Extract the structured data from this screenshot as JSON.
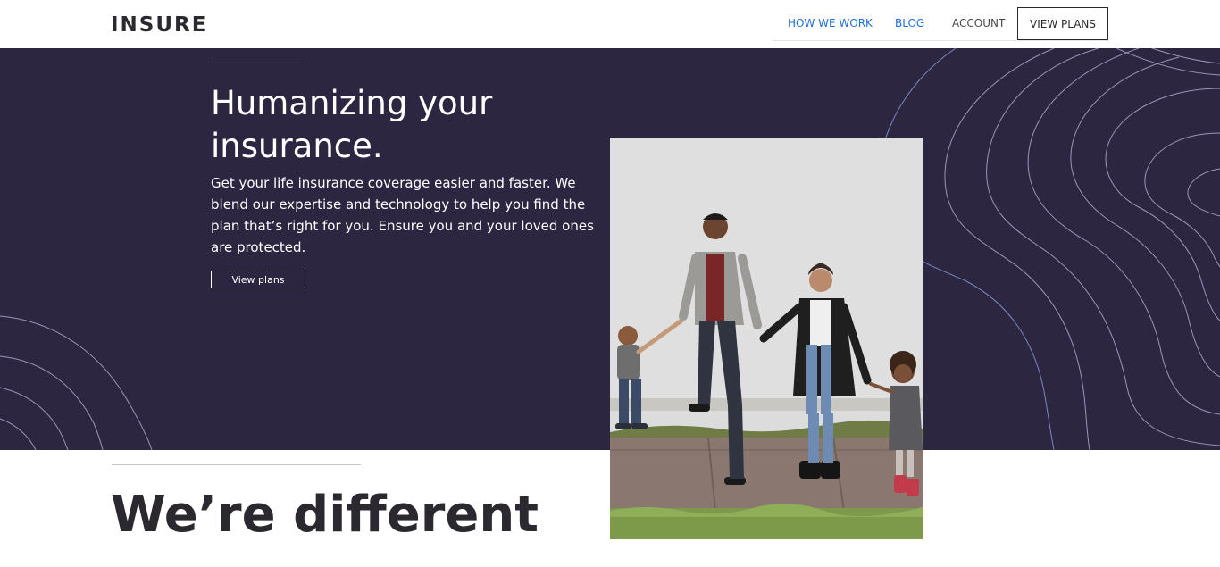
{
  "header": {
    "logo": "INSURE",
    "nav": {
      "how_we_work": "HOW WE WORK",
      "blog": "BLOG",
      "account": "ACCOUNT",
      "view_plans": "VIEW PLANS"
    }
  },
  "hero": {
    "title": "Humanizing your insurance.",
    "description": "Get your life insurance coverage easier and faster. We blend our expertise and technology to help you find the plan that’s right for you. Ensure you and your loved ones are protected.",
    "button": "View plans",
    "background_color": "#2c2640"
  },
  "photo": {
    "subject": "family-walking-photo"
  },
  "section": {
    "title": "We’re different"
  },
  "colors": {
    "dark_violet": "#2c2640",
    "link_blue": "#1d6fd6",
    "text_dark": "#2c2830"
  }
}
